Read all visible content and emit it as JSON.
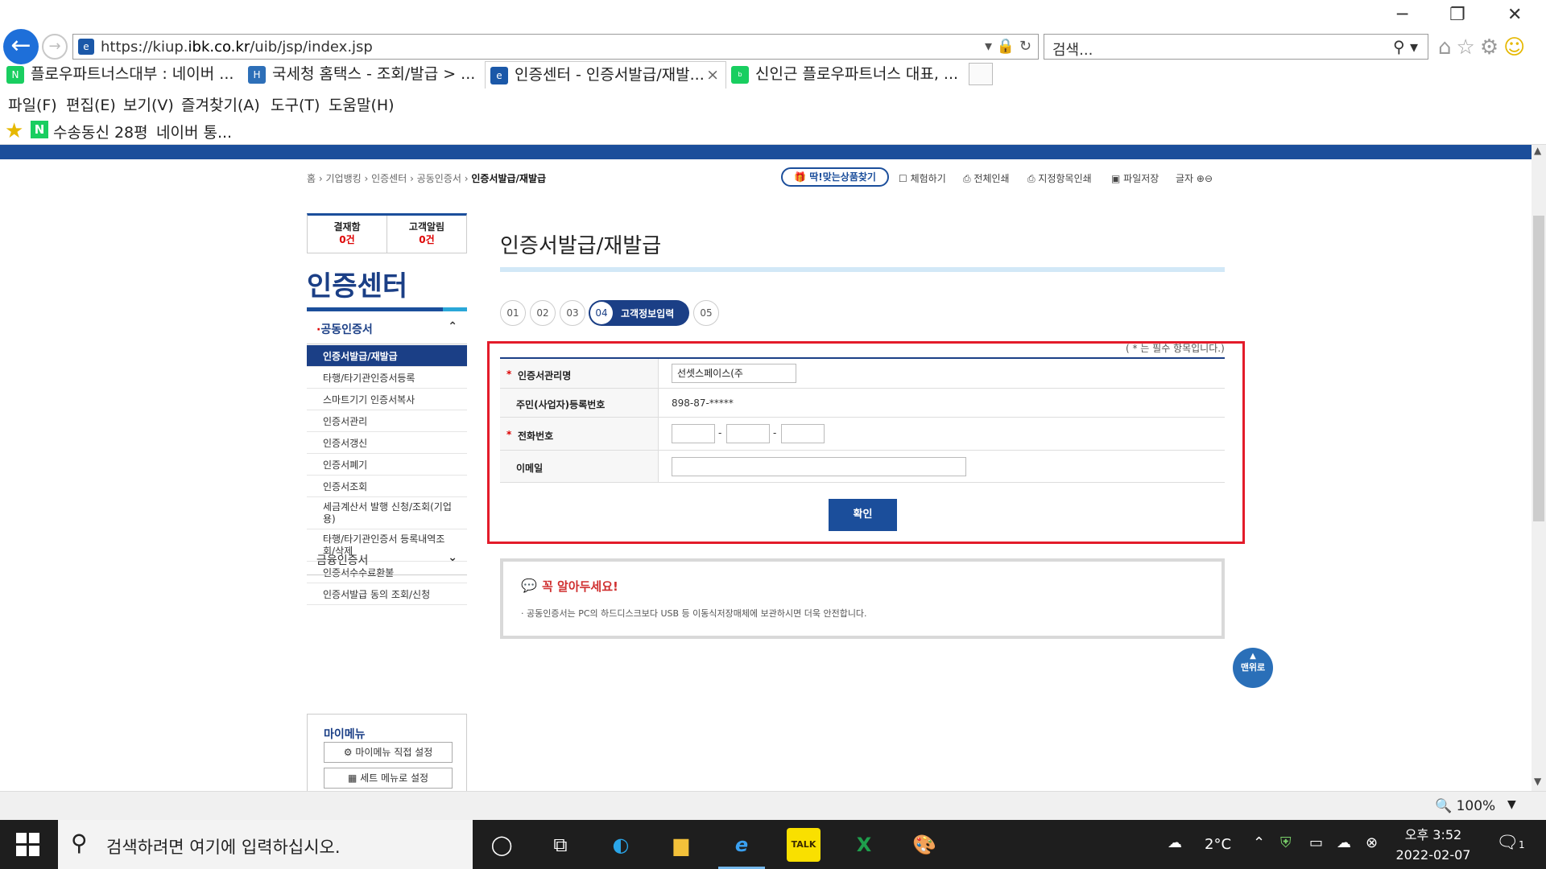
{
  "browser": {
    "url_prefix": "https://kiup.",
    "url_host": "ibk.co.kr",
    "url_path": "/uib/jsp/index.jsp",
    "search_placeholder": "검색...",
    "tabs": [
      {
        "label": "플로우파트너스대부 : 네이버 ...",
        "icon": "N",
        "color": "#19ce60"
      },
      {
        "label": "국세청 홈택스 - 조회/발급 > ...",
        "icon": "H",
        "color": "#2d6fb8"
      },
      {
        "label": "인증센터 - 인증서발급/재발...",
        "icon": "e",
        "color": "#1b58a8"
      },
      {
        "label": "신인근 플로우파트너스 대표, ...",
        "icon": "b",
        "color": "#19ce60"
      }
    ],
    "tab_close": "×",
    "menu": [
      "파일(F)",
      "편집(E)",
      "보기(V)",
      "즐겨찾기(A)",
      "도구(T)",
      "도움말(H)"
    ],
    "favorites": [
      "수송동신 28평",
      "네이버 통..."
    ],
    "zoom": "100%"
  },
  "site": {
    "breadcrumb": [
      "홈",
      "기업뱅킹",
      "인증센터",
      "공동인증서"
    ],
    "breadcrumb_current": "인증서발급/재발급",
    "util": {
      "product_btn": "딱!맞는상품찾기",
      "items": [
        "체험하기",
        "전체인쇄",
        "지정항목인쇄",
        "파일저장",
        "글자"
      ]
    },
    "alarm": [
      {
        "label": "결재함",
        "count": "0건"
      },
      {
        "label": "고객알림",
        "count": "0건"
      }
    ],
    "side_title": "인증센터",
    "side_cat_open": "공동인증서",
    "side_items": [
      "인증서발급/재발급",
      "타행/타기관인증서등록",
      "스마트기기 인증서복사",
      "인증서관리",
      "인증서갱신",
      "인증서폐기",
      "인증서조회",
      "세금계산서 발행 신청/조회(기업용)",
      "타행/타기관인증서 등록내역조회/삭제",
      "인증서수수료환불",
      "인증서발급 동의 조회/신청"
    ],
    "side_cat_closed": "금융인증서",
    "mymenu": {
      "title": "마이메뉴",
      "btn1": "마이메뉴 직접 설정",
      "btn2": "세트 메뉴로 설정"
    }
  },
  "content": {
    "title": "인증서발급/재발급",
    "steps": [
      "01",
      "02",
      "03",
      "04",
      "05"
    ],
    "active_step_label": "고객정보입력",
    "required_note": "( * 는 필수 항목입니다.)",
    "form": {
      "cert_name_label": "인증서관리명",
      "cert_name_value": "선셋스페이스(주",
      "biz_no_label": "주민(사업자)등록번호",
      "biz_no_value": "898-87-*****",
      "phone_label": "전화번호",
      "email_label": "이메일",
      "required_mark": "*",
      "dash": "-"
    },
    "confirm": "확인",
    "notice_title": "꼭 알아두세요!",
    "notice_body": "·  공동인증서는 PC의 하드디스크보다 USB 등 이동식저장매체에 보관하시면 더욱 안전합니다.",
    "top_btn": "맨위로"
  },
  "taskbar": {
    "search_placeholder": "검색하려면 여기에 입력하십시오.",
    "weather": "2°C",
    "time": "오후 3:52",
    "date": "2022-02-07",
    "notif_count": "1"
  }
}
